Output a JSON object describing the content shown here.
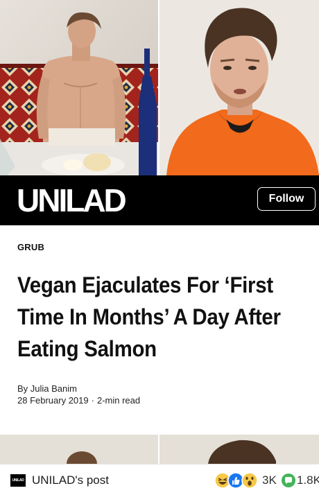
{
  "brand": {
    "name": "UNILAD",
    "follow_label": "Follow"
  },
  "article": {
    "category": "GRUB",
    "headline": "Vegan Ejaculates For ‘First Time In Months’ A Day After Eating Salmon",
    "byline": "By Julia Banim",
    "date": "28 February 2019",
    "separator": "·",
    "read_time": "2-min read"
  },
  "footer": {
    "mini_logo": "UNILAD",
    "post_label": "UNILAD's post",
    "reaction_count": "3K",
    "comment_count": "1.8K"
  },
  "icons": [
    "haha-reaction-icon",
    "like-reaction-icon",
    "wow-reaction-icon",
    "comment-icon"
  ],
  "colors": {
    "brand_bar": "#000000",
    "hoodie": "#f26a1b",
    "like_blue": "#1877f2",
    "reaction_yellow": "#f7c948",
    "comment_green": "#44b35a"
  }
}
